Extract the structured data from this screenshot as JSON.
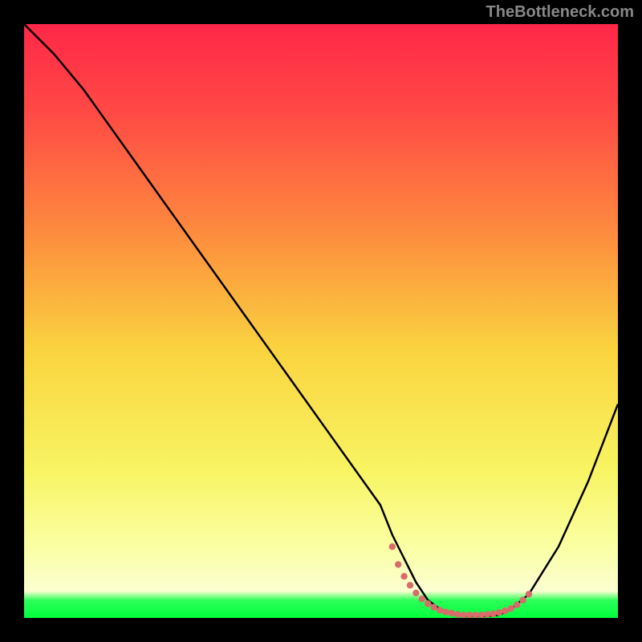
{
  "watermark": "TheBottleneck.com",
  "chart_data": {
    "type": "line",
    "title": "",
    "xlabel": "",
    "ylabel": "",
    "xlim": [
      0,
      100
    ],
    "ylim": [
      0,
      100
    ],
    "series": [
      {
        "name": "main-curve",
        "color": "#000000",
        "x": [
          0,
          5,
          10,
          15,
          20,
          25,
          30,
          35,
          40,
          45,
          50,
          55,
          60,
          62,
          64,
          66,
          68,
          70,
          72,
          74,
          76,
          78,
          80,
          82,
          85,
          90,
          95,
          100
        ],
        "y": [
          100,
          95,
          89,
          82,
          75,
          68,
          61,
          54,
          47,
          40,
          33,
          26,
          19,
          14,
          10,
          6,
          3,
          1.5,
          0.7,
          0.3,
          0.3,
          0.3,
          0.5,
          1.5,
          4,
          12,
          23,
          36
        ]
      },
      {
        "name": "dotted-min",
        "color": "#d96b6b",
        "style": "dotted",
        "x": [
          62,
          63,
          64,
          65,
          66,
          67,
          68,
          69,
          70,
          71,
          72,
          73,
          74,
          75,
          76,
          77,
          78,
          79,
          80,
          81,
          82,
          83,
          84,
          85
        ],
        "y": [
          12,
          9,
          7,
          5.5,
          4.2,
          3.2,
          2.4,
          1.8,
          1.3,
          1.0,
          0.8,
          0.6,
          0.5,
          0.5,
          0.5,
          0.5,
          0.6,
          0.7,
          0.9,
          1.2,
          1.6,
          2.2,
          3.0,
          4.0
        ]
      }
    ],
    "gradient_stops": [
      {
        "offset": 0,
        "color": "#ff2748"
      },
      {
        "offset": 0.15,
        "color": "#ff4a45"
      },
      {
        "offset": 0.35,
        "color": "#fd8b3e"
      },
      {
        "offset": 0.55,
        "color": "#fad43f"
      },
      {
        "offset": 0.75,
        "color": "#f8f462"
      },
      {
        "offset": 0.88,
        "color": "#faffa3"
      },
      {
        "offset": 0.955,
        "color": "#fbffd1"
      },
      {
        "offset": 0.97,
        "color": "#2eff5a"
      },
      {
        "offset": 1.0,
        "color": "#00ff3c"
      }
    ]
  }
}
